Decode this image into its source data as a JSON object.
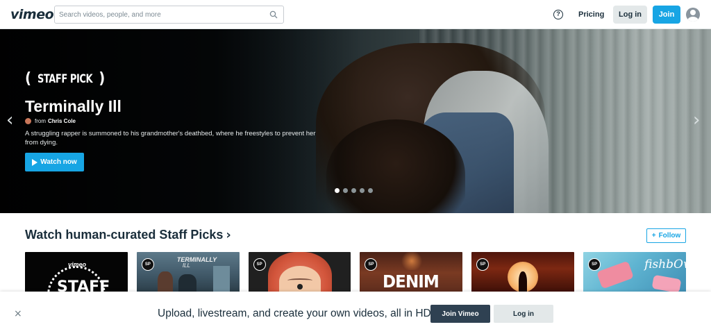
{
  "nav": {
    "logo": "vimeo",
    "search_placeholder": "Search videos, people, and more",
    "help_glyph": "?",
    "pricing": "Pricing",
    "login": "Log in",
    "join": "Join"
  },
  "hero": {
    "badge": "STAFF PICK",
    "title": "Terminally Ill",
    "from": "from",
    "author": "Chris Cole",
    "description": "A struggling rapper is summoned to his grandmother's deathbed, where he freestyles to prevent her from dying.",
    "watch_label": "Watch now",
    "slides": 5,
    "active_slide": 1
  },
  "section": {
    "title": "Watch human-curated Staff Picks",
    "chevron": "›",
    "follow_label": "Follow",
    "follow_plus": "+"
  },
  "thumbnails": [
    {
      "brand": "vimeo",
      "word": "STAFF",
      "badge": ""
    },
    {
      "word": "TERMINALLY",
      "word2": "ILL",
      "badge": "SP"
    },
    {
      "badge": "SP"
    },
    {
      "word": "DENIM",
      "badge": "SP"
    },
    {
      "badge": "SP"
    },
    {
      "word": "fishbOwl",
      "badge": "SP"
    }
  ],
  "banner": {
    "message": "Upload, livestream, and create your own videos, all in HD.",
    "join_label": "Join Vimeo",
    "login_label": "Log in",
    "close_glyph": "×"
  },
  "colors": {
    "accent": "#17a5e4",
    "text_dark": "#1a2e3b",
    "button_dark": "#2f4152",
    "button_light": "#e3e8e9"
  }
}
